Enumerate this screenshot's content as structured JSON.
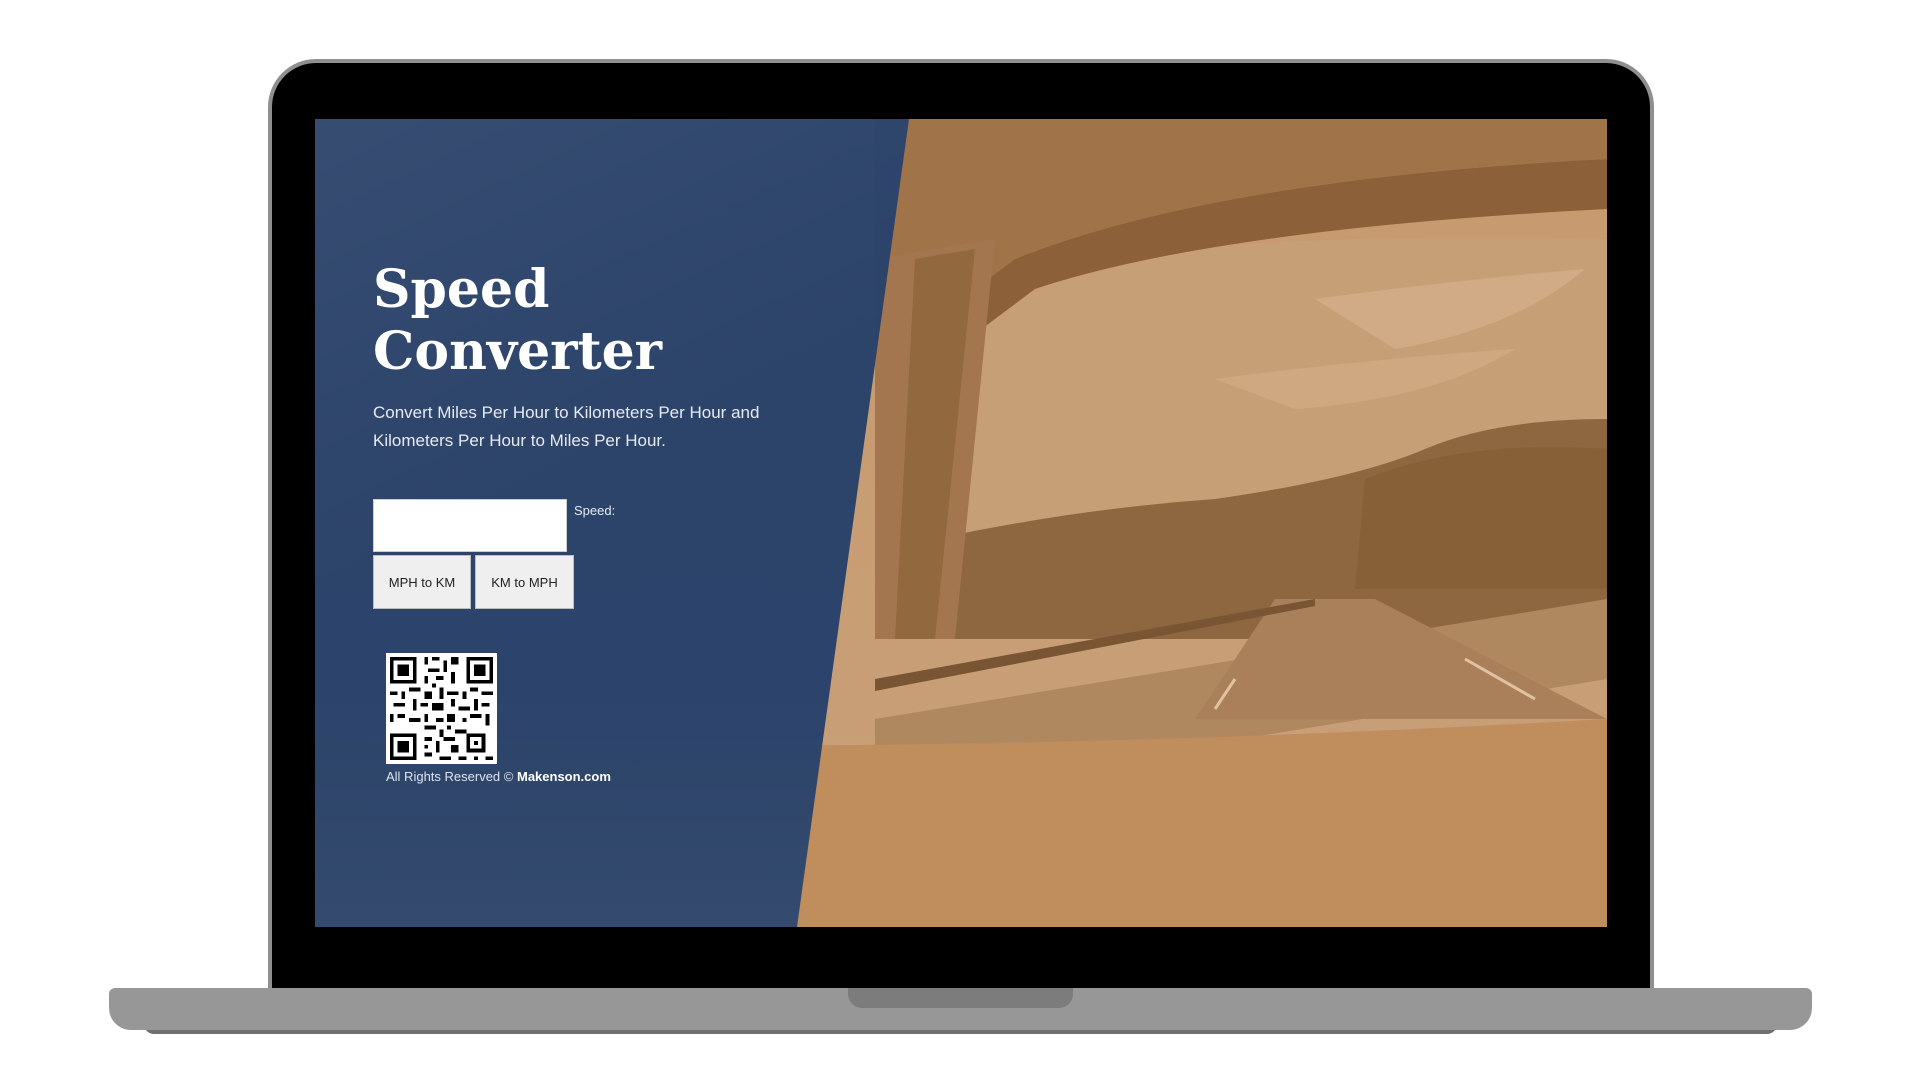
{
  "app": {
    "title": "Speed\nConverter",
    "description": "Convert Miles Per Hour to Kilometers Per Hour and Kilometers Per Hour to Miles Per Hour."
  },
  "form": {
    "speed_value": "",
    "speed_label": "Speed:",
    "mph_to_km_label": "MPH to KM",
    "km_to_mph_label": "KM to MPH"
  },
  "footer": {
    "rights_text": "All Rights Reserved ©",
    "brand": "Makenson.com"
  },
  "icons": {
    "qr": "qr-code-icon"
  },
  "colors": {
    "panel_blue": "#253f6a",
    "photo_tint": "#c4905e",
    "button_bg": "#efefef"
  }
}
